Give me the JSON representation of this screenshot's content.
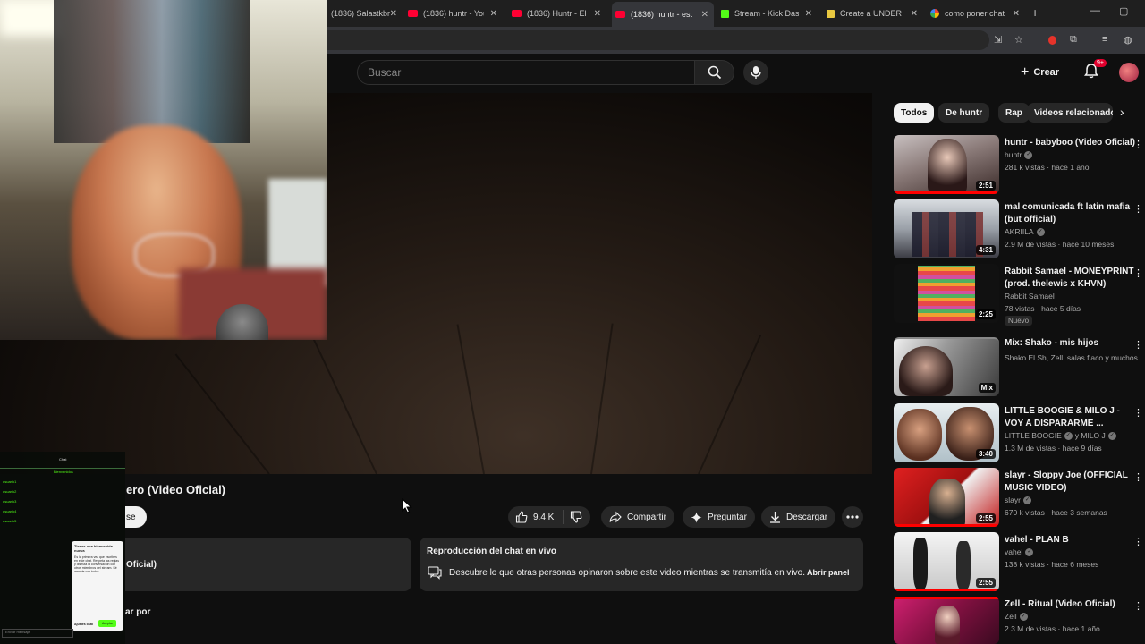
{
  "browser": {
    "tabs": [
      {
        "label": "(1836) Salastkbro",
        "icon": "youtube-icon"
      },
      {
        "label": "(1836) huntr - You",
        "icon": "youtube-icon"
      },
      {
        "label": "(1836) Huntr - El",
        "icon": "youtube-icon"
      },
      {
        "label": "(1836) huntr - est",
        "icon": "youtube-icon",
        "active": true
      },
      {
        "label": "Stream - Kick Das",
        "icon": "kick-icon"
      },
      {
        "label": "Create a UNDER",
        "icon": "doc-icon"
      },
      {
        "label": "como poner chat",
        "icon": "google-icon"
      }
    ],
    "new_tab": "+",
    "minimize": "—",
    "maximize": "▢"
  },
  "masthead": {
    "search_placeholder": "Buscar",
    "create_label": "Crear",
    "notif_badge": "9+"
  },
  "stream_overlay": {
    "chat_title": "Chat",
    "chat_subtitle": "Bienvenidos",
    "chat_lines": [
      {
        "user": "usuario1",
        "text": ""
      },
      {
        "user": "usuario2",
        "text": ""
      },
      {
        "user": "usuario3",
        "text": ""
      },
      {
        "user": "usuario4",
        "text": ""
      },
      {
        "user": "usuario5",
        "text": ""
      }
    ],
    "card_title": "Tienes una bienvenida nueva",
    "card_body": "Es la primera vez que escribes en este chat. Respeta las reglas y disfruta la conversación con otros miembros del stream. Sé amable con todos.",
    "card_link": "Ajustes chat",
    "card_button": "Aceptar",
    "input_placeholder": "Enviar mensaje"
  },
  "video": {
    "title_visible": "ero (Video Oficial)",
    "subscribe_fragment": "se",
    "like_count": "9.4 K",
    "share_label": "Compartir",
    "ask_label": "Preguntar",
    "download_label": "Descargar"
  },
  "description": {
    "text_visible": "Oficial)"
  },
  "live_chat": {
    "title": "Reproducción del chat en vivo",
    "desc": "Descubre lo que otras personas opinaron sobre este video mientras se transmitía en vivo.",
    "button": "Abrir panel"
  },
  "comments": {
    "sort_visible": "ar por"
  },
  "sidebar": {
    "chips": [
      "Todos",
      "De huntr",
      "Rap",
      "Videos relacionados"
    ],
    "recommendations": [
      {
        "title": "huntr - babyboo (Video Oficial)",
        "channel": "huntr",
        "verified": true,
        "meta": "281 k vistas · hace 1 año",
        "duration": "2:51",
        "progress": 0.98
      },
      {
        "title": "mal comunicada ft latin mafia (but official)",
        "channel": "AKRIILA",
        "verified": true,
        "meta": "2.9 M de vistas · hace 10 meses",
        "duration": "4:31",
        "progress": 0
      },
      {
        "title": "Rabbit Samael - MONEYPRINT (prod. thelewis x KHVN)",
        "channel": "Rabbit Samael",
        "verified": false,
        "meta": "78 vistas · hace 5 días",
        "duration": "2:25",
        "progress": 0,
        "badge": "Nuevo"
      },
      {
        "title": "Mix: Shako - mis hijos",
        "channel": "Shako El Sh, Zell, salas flaco y muchos más",
        "verified": false,
        "meta": "",
        "duration": "Mix",
        "progress": 0
      },
      {
        "title": "LITTLE BOOGIE & MILO J - VOY A DISPARARME ...",
        "channel": "LITTLE BOOGIE",
        "channel2": "y MILO J",
        "verified": true,
        "meta": "1.3 M de vistas · hace 9 días",
        "duration": "3:40",
        "progress": 0
      },
      {
        "title": "slayr - Sloppy Joe (OFFICIAL MUSIC VIDEO)",
        "channel": "slayr",
        "verified": true,
        "meta": "670 k vistas · hace 3 semanas",
        "duration": "2:55",
        "progress": 1.0
      },
      {
        "title": "vahel - PLAN B",
        "channel": "vahel",
        "verified": true,
        "meta": "138 k vistas · hace 6 meses",
        "duration": "2:55",
        "progress": 1.0
      },
      {
        "title": "Zell - Ritual (Video Oficial)",
        "channel": "Zell",
        "verified": true,
        "meta": "2.3 M de vistas · hace 1 año",
        "duration": "",
        "progress": 1.0
      }
    ]
  },
  "colors": {
    "background": "#0f0f0f",
    "surface": "#272727",
    "accent_red": "#ff0000",
    "kick_green": "#53fc18"
  }
}
